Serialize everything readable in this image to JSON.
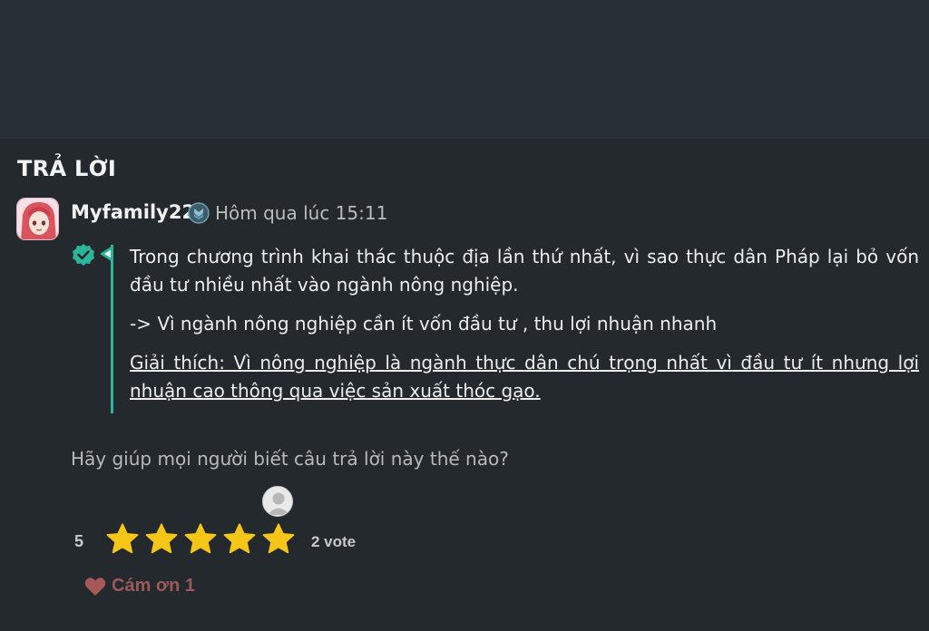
{
  "section": {
    "title": "TRẢ LỜI"
  },
  "answer": {
    "username": "Myfamily22",
    "timestamp": "Hôm qua lúc 15:11",
    "paragraphs": [
      "Trong chương trình khai thác thuộc địa lần thứ nhất, vì sao thực dân Pháp lại bỏ vốn đầu tư nhiều nhất vào ngành nông nghiệp.",
      "-> Vì ngành nông nghiệp cần ít vốn đầu tư , thu lợi nhuận nhanh",
      "Giải thích: Vì nông nghiệp là ngành thực dân chú trọng nhất vì đầu tư ít nhưng lợi nhuận cao thông qua việc sản xuất thóc gạo."
    ]
  },
  "feedback": {
    "prompt": "Hãy giúp mọi người biết câu trả lời này thế nào?",
    "score": "5",
    "stars_filled": 5,
    "stars_total": 5,
    "votes": "2 vote",
    "thanks_label": "Cám ơn 1"
  },
  "colors": {
    "accent": "#2bb59a",
    "star": "#f5c518",
    "heart": "#a65858"
  }
}
